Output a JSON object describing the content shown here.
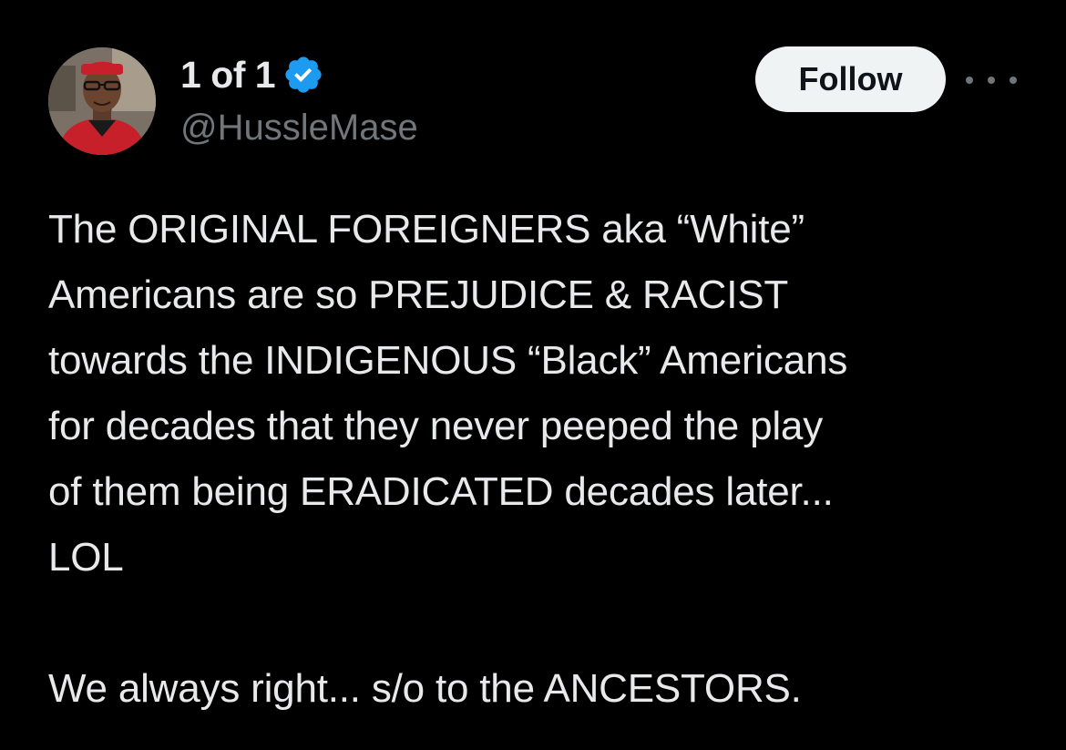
{
  "author": {
    "display_name": "1 of 1",
    "handle": "@HussleMase",
    "verified": true,
    "verified_color": "#1d9bf0",
    "avatar_icon": "avatar-photo"
  },
  "actions": {
    "follow_label": "Follow",
    "more_icon": "ellipsis-icon"
  },
  "tweet": {
    "paragraph1": [
      "The ORIGINAL FOREIGNERS aka “White”",
      "Americans are so PREJUDICE & RACIST",
      "towards the INDIGENOUS “Black” Americans",
      "for decades that they never peeped the play",
      "of them being ERADICATED decades later...",
      "LOL"
    ],
    "paragraph2": [
      "We always right... s/o to the ANCESTORS."
    ]
  },
  "colors": {
    "background": "#000000",
    "primary_text": "#e7e9ea",
    "secondary_text": "#71767b",
    "follow_bg": "#eff3f4",
    "follow_text": "#0f1419"
  }
}
